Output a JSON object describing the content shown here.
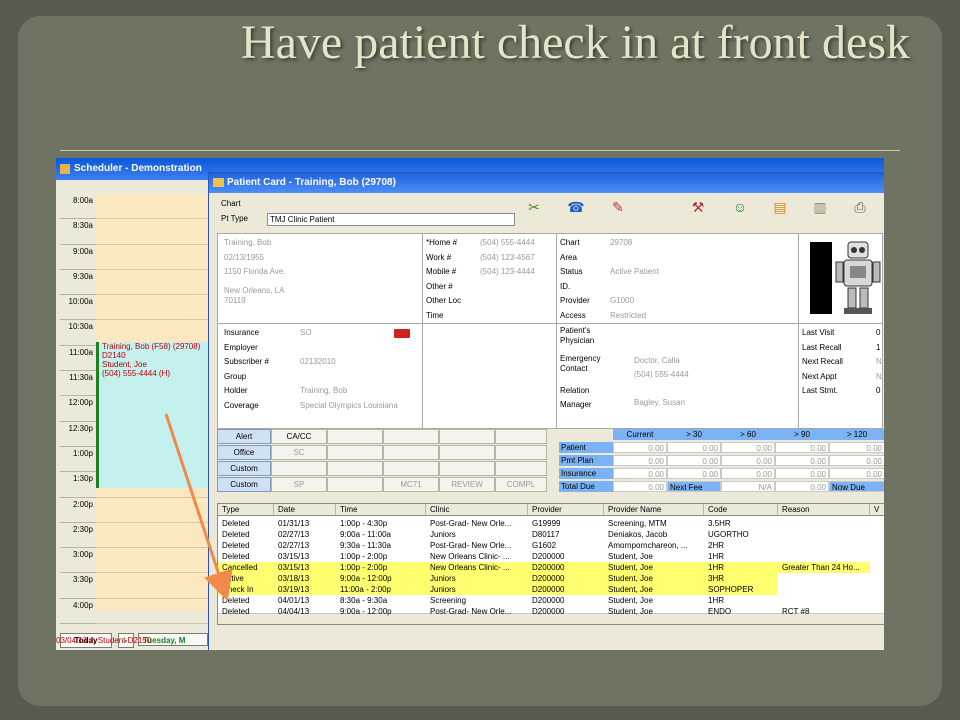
{
  "slide": {
    "title": "Have patient check in at front desk"
  },
  "scheduler": {
    "title": "Scheduler - Demonstration",
    "times": [
      "8:00a",
      "8:30a",
      "9:00a",
      "9:30a",
      "10:00a",
      "10:30a",
      "11:00a",
      "11:30a",
      "12:00p",
      "12:30p",
      "1:00p",
      "1:30p",
      "2:00p",
      "2:30p",
      "3:00p",
      "3:30p",
      "4:00p"
    ],
    "appointment": {
      "line1": "Training, Bob  (F58) (29708)",
      "line2": "D2140",
      "line3": "Student, Joe",
      "line4": "(504) 555-4444 (H)"
    },
    "today_label": "Today",
    "minus_label": "-",
    "date_label": "Tuesday, M",
    "bottom_row": "03/04/13    J. Student    D2150"
  },
  "patient_card": {
    "title": "Patient Card - Training, Bob (29708)",
    "chart_label": "Chart",
    "pt_type_label": "Pt Type",
    "pt_type_value": "TMJ Clinic Patient",
    "toolbar_icons": [
      "binder-icon",
      "phone-icon",
      "note-icon",
      "tools-icon",
      "contact-card-icon",
      "folder-icon",
      "card-reader-icon",
      "printer-icon"
    ],
    "demographics": {
      "name": "Training, Bob",
      "dob": "02/13/1955",
      "address1": "1150 Florida Ave.",
      "address2": "New Orleans, LA",
      "zip": "70119"
    },
    "phones": {
      "home_label": "*Home #",
      "home": "(504) 555-4444",
      "work_label": "Work #",
      "work": "(504) 123-4567",
      "mobile_label": "Mobile #",
      "mobile": "(504) 123-4444",
      "other_label": "Other #",
      "otherloc_label": "Other Loc",
      "time_label": "Time"
    },
    "chart_info": {
      "chart_label": "Chart",
      "chart": "29708",
      "area_label": "Area",
      "status_label": "Status",
      "status": "Active Patient",
      "id_label": "ID.",
      "provider_label": "Provider",
      "provider": "G1000",
      "access_label": "Access",
      "access": "Restricted"
    },
    "insurance": {
      "insurance_label": "Insurance",
      "insurance": "SO",
      "employer_label": "Employer",
      "subscriber_label": "Subscriber #",
      "subscriber": "02132010",
      "group_label": "Group",
      "holder_label": "Holder",
      "holder": "Training, Bob",
      "coverage_label": "Coverage",
      "coverage": "Special Olympics Louisiana"
    },
    "physician": {
      "patients_label": "Patient's",
      "physician_label": "Physician",
      "emergency_label": "Emergency",
      "contact_label": "Contact",
      "emergency_name": "Doctor, Calla",
      "emergency_phone": "(504) 555-4444",
      "relation_label": "Relation",
      "manager_label": "Manager",
      "manager": "Bagley, Susan"
    },
    "visits": {
      "last_visit_label": "Last Visit",
      "last_visit": "0",
      "last_recall_label": "Last Recall",
      "last_recall": "1",
      "next_recall_label": "Next Recall",
      "next_recall": "N",
      "next_appt_label": "Next Appt",
      "next_appt": "N",
      "last_stmt_label": "Last Stmt.",
      "last_stmt": "0"
    },
    "alerts": [
      {
        "button": "Alert",
        "cells": [
          "CA/CC",
          "",
          "",
          "",
          "",
          ""
        ]
      },
      {
        "button": "Office",
        "cells": [
          "SC",
          "",
          "",
          "",
          "",
          ""
        ]
      },
      {
        "button": "Custom",
        "cells": [
          "",
          "",
          "",
          "",
          "",
          ""
        ]
      },
      {
        "button": "Custom",
        "cells": [
          "SP",
          "",
          "MC71",
          "REVIEW",
          "COMPL",
          ""
        ]
      }
    ],
    "ar": {
      "headers": [
        "Current",
        "> 30",
        "> 60",
        "> 90",
        "> 120"
      ],
      "rows": [
        {
          "label": "Patient",
          "values": [
            "0.00",
            "0.00",
            "0.00",
            "0.00",
            "0.00"
          ]
        },
        {
          "label": "Pmt Plan",
          "values": [
            "0.00",
            "0.00",
            "0.00",
            "0.00",
            "0.00"
          ]
        },
        {
          "label": "Insurance",
          "values": [
            "0.00",
            "0.00",
            "0.00",
            "0.00",
            "0.00"
          ]
        },
        {
          "label": "Total Due",
          "values": [
            "0.00",
            "Next Fee",
            "N/A",
            "0.00",
            "Now Due"
          ]
        }
      ]
    },
    "appointments": {
      "headers": [
        "Type",
        "Date",
        "Time",
        "Clinic",
        "Provider",
        "Provider Name",
        "Code",
        "Reason",
        "V"
      ],
      "rows": [
        {
          "type": "Deleted",
          "date": "01/31/13",
          "time": "1:00p - 4:30p",
          "clinic": "Post-Grad- New Orle...",
          "provider": "G19999",
          "provider_name": "Screening, MTM",
          "code": "3.5HR",
          "reason": "",
          "hl": false
        },
        {
          "type": "Deleted",
          "date": "02/27/13",
          "time": "9:00a - 11:00a",
          "clinic": "Juniors",
          "provider": "D80117",
          "provider_name": "Deniakos, Jacob",
          "code": "UGORTHO",
          "reason": "",
          "hl": false
        },
        {
          "type": "Deleted",
          "date": "02/27/13",
          "time": "9:30a - 11:30a",
          "clinic": "Post-Grad- New Orle...",
          "provider": "G1602",
          "provider_name": "Amornpornchareon, ...",
          "code": "2HR",
          "reason": "",
          "hl": false
        },
        {
          "type": "Deleted",
          "date": "03/15/13",
          "time": "1:00p - 2:00p",
          "clinic": "New Orleans Clinic- ...",
          "provider": "D200000",
          "provider_name": "Student, Joe",
          "code": "1HR",
          "reason": "",
          "hl": false
        },
        {
          "type": "Cancelled",
          "date": "03/15/13",
          "time": "1:00p - 2:00p",
          "clinic": "New Orleans Clinic- ...",
          "provider": "D200000",
          "provider_name": "Student, Joe",
          "code": "1HR",
          "reason": "Greater Than 24 Ho...",
          "hl": true
        },
        {
          "type": "Active",
          "date": "03/18/13",
          "time": "9:00a - 12:00p",
          "clinic": "Juniors",
          "provider": "D200000",
          "provider_name": "Student, Joe",
          "code": "3HR",
          "reason": "",
          "hl": true
        },
        {
          "type": "Check In",
          "date": "03/19/13",
          "time": "11:00a - 2:00p",
          "clinic": "Juniors",
          "provider": "D200000",
          "provider_name": "Student, Joe",
          "code": "SOPHOPER",
          "reason": "",
          "hl": true
        },
        {
          "type": "Deleted",
          "date": "04/01/13",
          "time": "8:30a - 9:30a",
          "clinic": "Screening",
          "provider": "D200000",
          "provider_name": "Student, Joe",
          "code": "1HR",
          "reason": "",
          "hl": false
        },
        {
          "type": "Deleted",
          "date": "04/04/13",
          "time": "9:00a - 12:00p",
          "clinic": "Post-Grad- New Orle...",
          "provider": "D200000",
          "provider_name": "Student, Joe",
          "code": "ENDO",
          "reason": "RCT #8",
          "hl": false
        }
      ]
    }
  },
  "colors": {
    "slide_bg": "#6e7461",
    "title_text": "#e6e4c8",
    "titlebar_blue": "#1f63df",
    "highlight_yellow": "#ffff70",
    "arrow_orange": "#f08a4a"
  }
}
